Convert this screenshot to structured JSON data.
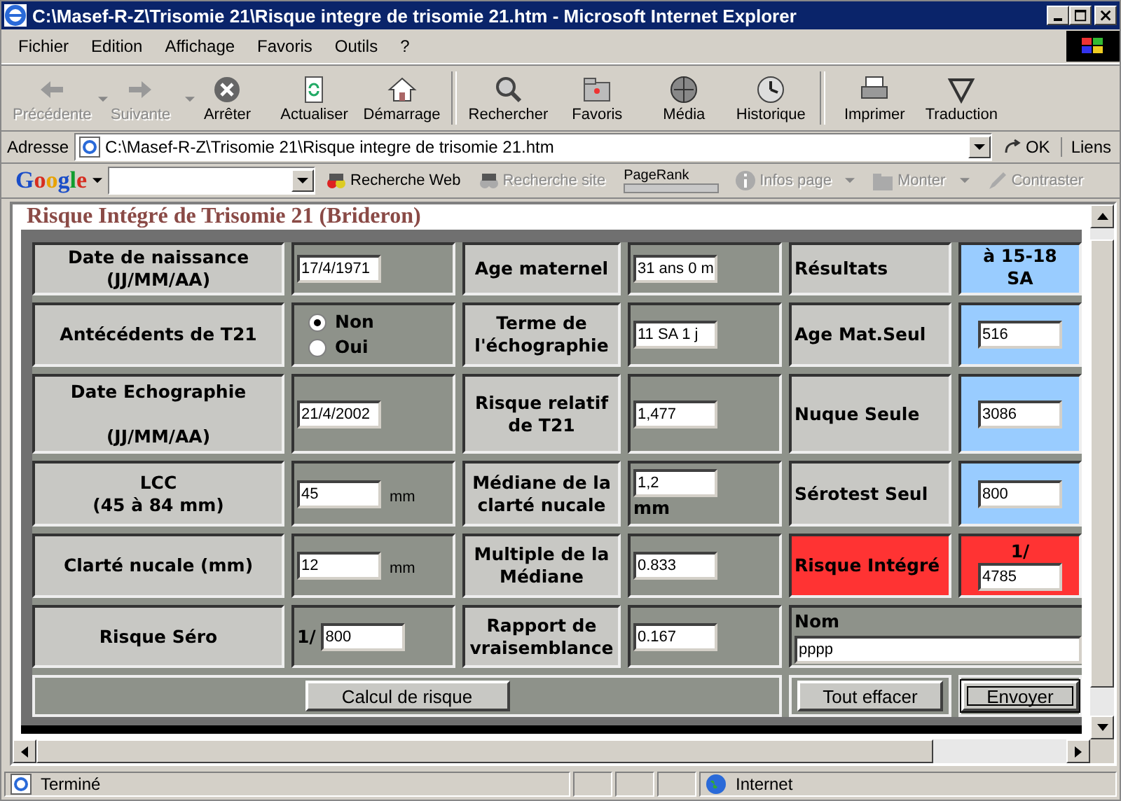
{
  "window": {
    "title": "C:\\Masef-R-Z\\Trisomie 21\\Risque integre de trisomie 21.htm - Microsoft Internet Explorer"
  },
  "menu": [
    "Fichier",
    "Edition",
    "Affichage",
    "Favoris",
    "Outils",
    "?"
  ],
  "toolbar": [
    {
      "label": "Précédente",
      "disabled": true,
      "dropdown": true,
      "separator_before": false
    },
    {
      "label": "Suivante",
      "disabled": true,
      "dropdown": true,
      "separator_before": false
    },
    {
      "label": "Arrêter",
      "disabled": false,
      "dropdown": false,
      "separator_before": false
    },
    {
      "label": "Actualiser",
      "disabled": false,
      "dropdown": false,
      "separator_before": false
    },
    {
      "label": "Démarrage",
      "disabled": false,
      "dropdown": false,
      "separator_before": false
    },
    {
      "label": "Rechercher",
      "disabled": false,
      "dropdown": false,
      "separator_before": true
    },
    {
      "label": "Favoris",
      "disabled": false,
      "dropdown": false,
      "separator_before": false
    },
    {
      "label": "Média",
      "disabled": false,
      "dropdown": false,
      "separator_before": false
    },
    {
      "label": "Historique",
      "disabled": false,
      "dropdown": false,
      "separator_before": false
    },
    {
      "label": "Imprimer",
      "disabled": false,
      "dropdown": false,
      "separator_before": true
    },
    {
      "label": "Traduction",
      "disabled": false,
      "dropdown": false,
      "separator_before": false
    }
  ],
  "address": {
    "label": "Adresse",
    "value": "C:\\Masef-R-Z\\Trisomie 21\\Risque integre de trisomie 21.htm",
    "go": "OK",
    "links": "Liens"
  },
  "google": {
    "logo": "Google",
    "items": [
      {
        "kind": "search",
        "label": "Recherche Web",
        "disabled": false,
        "dropdown": false
      },
      {
        "kind": "site",
        "label": "Recherche site",
        "disabled": true,
        "dropdown": false
      },
      {
        "kind": "pagerank",
        "label": "PageRank"
      },
      {
        "kind": "info",
        "label": "Infos page",
        "disabled": true,
        "dropdown": true
      },
      {
        "kind": "folder",
        "label": "Monter",
        "disabled": true,
        "dropdown": true
      },
      {
        "kind": "pen",
        "label": "Contraster",
        "disabled": true,
        "dropdown": false
      }
    ]
  },
  "page": {
    "heading": "Risque Intégré de Trisomie 21 (Brideron)"
  },
  "form": {
    "rows": [
      {
        "cells": [
          {
            "kind": "label",
            "text": "Date de naissance\n(JJ/MM/AA)"
          },
          {
            "kind": "input",
            "value": "17/4/1971"
          },
          {
            "kind": "label",
            "text": "Age maternel"
          },
          {
            "kind": "input",
            "value": "31 ans 0 m"
          },
          {
            "kind": "result_label",
            "text": "Résultats"
          },
          {
            "kind": "result_header",
            "text": "à 15-18 SA"
          }
        ]
      },
      {
        "cells": [
          {
            "kind": "label",
            "text": "Antécédents de T21"
          },
          {
            "kind": "radio",
            "options": [
              {
                "label": "Non",
                "selected": true
              },
              {
                "label": "Oui",
                "selected": false
              }
            ]
          },
          {
            "kind": "label",
            "text": "Terme de l'échographie"
          },
          {
            "kind": "input",
            "value": "11 SA 1 j"
          },
          {
            "kind": "result_label",
            "text": "Age Mat.Seul"
          },
          {
            "kind": "result_value",
            "value": "516"
          }
        ]
      },
      {
        "cells": [
          {
            "kind": "label",
            "text": "Date Echographie\n\n(JJ/MM/AA)"
          },
          {
            "kind": "input",
            "value": "21/4/2002"
          },
          {
            "kind": "label",
            "text": "Risque relatif de T21"
          },
          {
            "kind": "input",
            "value": "1,477"
          },
          {
            "kind": "result_label",
            "text": "Nuque Seule"
          },
          {
            "kind": "result_value",
            "value": "3086"
          }
        ]
      },
      {
        "cells": [
          {
            "kind": "label",
            "text": "LCC\n(45 à 84 mm)"
          },
          {
            "kind": "input",
            "value": "45",
            "unit": "mm"
          },
          {
            "kind": "label",
            "text": "Médiane de la clarté nucale"
          },
          {
            "kind": "stacked_input",
            "value": "1,2",
            "unit": "mm"
          },
          {
            "kind": "result_label",
            "text": "Sérotest Seul"
          },
          {
            "kind": "result_value",
            "value": "800"
          }
        ]
      },
      {
        "cells": [
          {
            "kind": "label",
            "text": "Clarté nucale (mm)"
          },
          {
            "kind": "input",
            "value": "12",
            "unit": "mm"
          },
          {
            "kind": "label",
            "text": "Multiple de la Médiane"
          },
          {
            "kind": "input",
            "value": "0.833"
          },
          {
            "kind": "risk_label",
            "text": "Risque Intégré"
          },
          {
            "kind": "risk_value",
            "prefix": "1/",
            "value": "4785"
          }
        ]
      },
      {
        "cells": [
          {
            "kind": "label",
            "text": "Risque Séro"
          },
          {
            "kind": "input",
            "prefix": "1/",
            "value": "800"
          },
          {
            "kind": "label",
            "text": "Rapport de vraisemblance"
          },
          {
            "kind": "input",
            "value": "0.167"
          },
          {
            "kind": "name_field",
            "label": "Nom",
            "value": "pppp"
          }
        ]
      }
    ],
    "actions": [
      {
        "label": "Calcul de risque",
        "focused": false
      },
      {
        "label": "Tout effacer",
        "focused": false
      },
      {
        "label": "Envoyer",
        "focused": true
      }
    ]
  },
  "status_bar": {
    "text": "Terminé",
    "zone": "Internet"
  }
}
